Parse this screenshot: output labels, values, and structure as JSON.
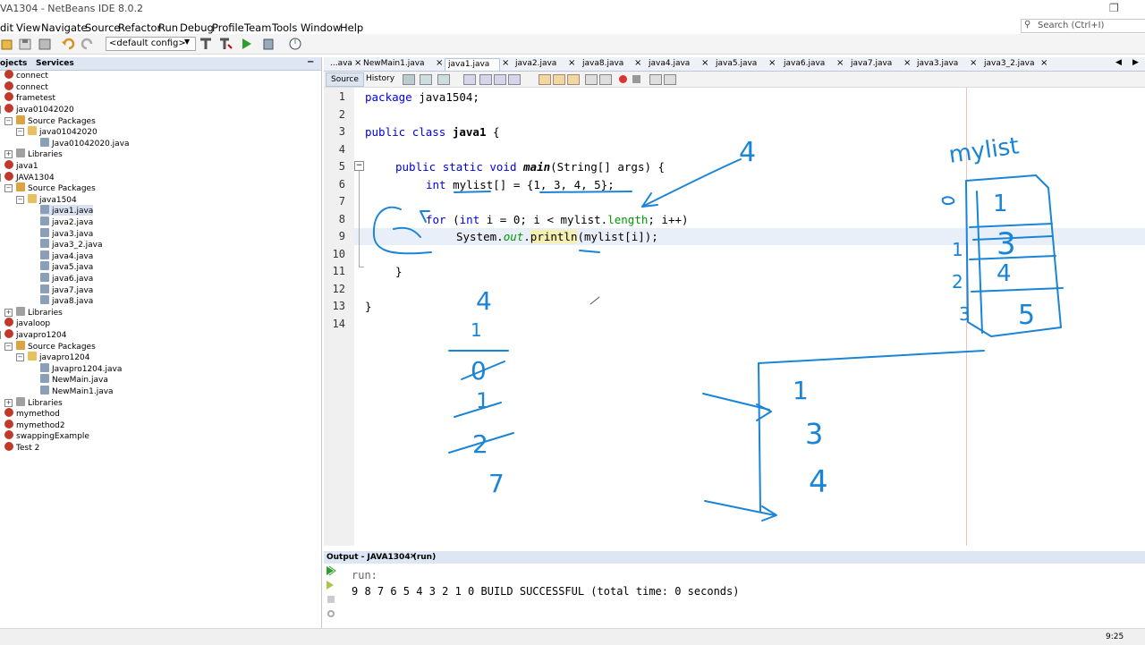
{
  "window": {
    "title": "VA1304 - NetBeans IDE 8.0.2"
  },
  "menu": [
    "dit",
    "View",
    "Navigate",
    "Source",
    "Refactor",
    "Run",
    "Debug",
    "Profile",
    "Team",
    "Tools",
    "Window",
    "Help"
  ],
  "search": {
    "placeholder": "Search (Ctrl+I)"
  },
  "toolbar": {
    "config": "<default config>"
  },
  "projects_panel": {
    "tabs": [
      "ojects",
      "Services"
    ],
    "tree": [
      {
        "label": "connect"
      },
      {
        "label": "connect"
      },
      {
        "label": "frametest"
      },
      {
        "label": "java01042020"
      },
      {
        "label": "Source Packages"
      },
      {
        "label": "java01042020"
      },
      {
        "label": "Java01042020.java"
      },
      {
        "label": "Libraries"
      },
      {
        "label": "java1"
      },
      {
        "label": "JAVA1304"
      },
      {
        "label": "Source Packages"
      },
      {
        "label": "java1504"
      },
      {
        "label": "java1.java"
      },
      {
        "label": "java2.java"
      },
      {
        "label": "java3.java"
      },
      {
        "label": "java3_2.java"
      },
      {
        "label": "java4.java"
      },
      {
        "label": "java5.java"
      },
      {
        "label": "java6.java"
      },
      {
        "label": "java7.java"
      },
      {
        "label": "java8.java"
      },
      {
        "label": "Libraries"
      },
      {
        "label": "javaloop"
      },
      {
        "label": "javapro1204"
      },
      {
        "label": "Source Packages"
      },
      {
        "label": "javapro1204"
      },
      {
        "label": "Javapro1204.java"
      },
      {
        "label": "NewMain.java"
      },
      {
        "label": "NewMain1.java"
      },
      {
        "label": "Libraries"
      },
      {
        "label": "mymethod"
      },
      {
        "label": "mymethod2"
      },
      {
        "label": "swappingExample"
      },
      {
        "label": "Test 2"
      }
    ]
  },
  "editor": {
    "tabs": [
      "...ava",
      "NewMain1.java",
      "java1.java",
      "java2.java",
      "java8.java",
      "java4.java",
      "java5.java",
      "java6.java",
      "java7.java",
      "java3.java",
      "java3_2.java"
    ],
    "subtabs": [
      "Source",
      "History"
    ],
    "line_numbers": [
      "1",
      "2",
      "3",
      "4",
      "5",
      "6",
      "7",
      "8",
      "9",
      "10",
      "11",
      "12",
      "13",
      "14"
    ],
    "code": {
      "l1_kw": "package",
      "l1_rest": " java1504;",
      "l3_kw1": "public",
      "l3_kw2": "class",
      "l3_name": "java1",
      "l3_rest": " {",
      "l5_kw1": "public",
      "l5_kw2": "static",
      "l5_kw3": "void",
      "l5_name": "main",
      "l5_rest": "(String[] args) {",
      "l6_kw": "int",
      "l6_rest": " mylist[] = {1, 3, 4, 5};",
      "l8_kw1": "for",
      "l8_a": " (",
      "l8_kw2": "int",
      "l8_b": " i = 0; i < mylist.",
      "l8_len": "length",
      "l8_c": "; i++)",
      "l9_a": "System.",
      "l9_out": "out",
      "l9_dot": ".",
      "l9_call": "println",
      "l9_rest": "(mylist[i]);",
      "l11": "}",
      "l13": "}"
    }
  },
  "output": {
    "title": "Output - JAVA1304 (run)",
    "line1": "run:",
    "line2": "9 8 7 6 5 4 3 2 1 0 BUILD SUCCESSFUL (total time: 0 seconds)"
  },
  "status": {
    "position": "9:25"
  },
  "annotations": {
    "mylist_label": "mylist",
    "array_values": [
      "1",
      "3",
      "4",
      "5"
    ],
    "index_labels": [
      "0",
      "1",
      "2",
      "3"
    ],
    "arrow_label": "4",
    "scribble_column": [
      "4",
      "1",
      "0",
      "1",
      "2",
      "7"
    ],
    "loop_values": [
      "1",
      "3",
      "4"
    ]
  },
  "colors": {
    "ink": "#1a84d6",
    "keyword": "#0000e6",
    "field": "#009900"
  }
}
